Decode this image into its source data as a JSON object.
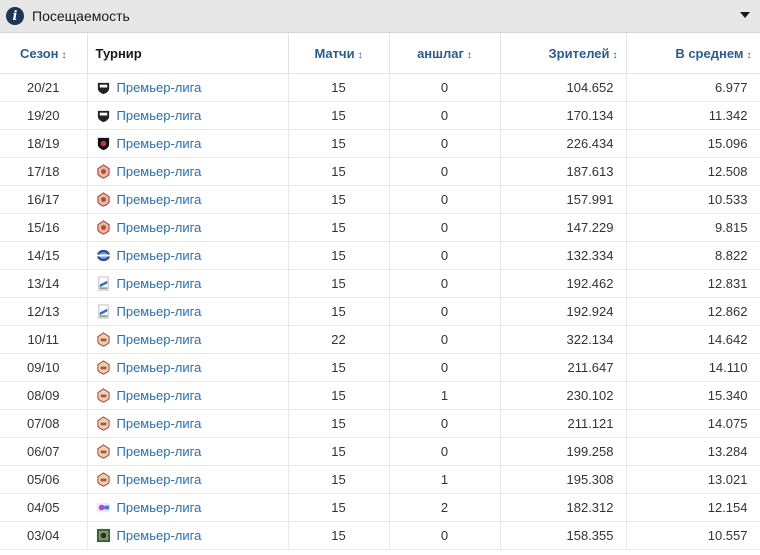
{
  "header": {
    "title": "Посещаемость"
  },
  "columns": [
    "Сезон",
    "Турнир",
    "Матчи",
    "аншлаг",
    "Зрителей",
    "В среднем"
  ],
  "rows": [
    {
      "season": "20/21",
      "league": "Премьер-лига",
      "logo": "black-shield-icon",
      "matches": "15",
      "sellouts": "0",
      "spectators": "104.652",
      "average": "6.977"
    },
    {
      "season": "19/20",
      "league": "Премьер-лига",
      "logo": "black-shield-icon",
      "matches": "15",
      "sellouts": "0",
      "spectators": "170.134",
      "average": "11.342"
    },
    {
      "season": "18/19",
      "league": "Премьер-лига",
      "logo": "black-lion-shield-icon",
      "matches": "15",
      "sellouts": "0",
      "spectators": "226.434",
      "average": "15.096"
    },
    {
      "season": "17/18",
      "league": "Премьер-лига",
      "logo": "red-lion-crest-icon",
      "matches": "15",
      "sellouts": "0",
      "spectators": "187.613",
      "average": "12.508"
    },
    {
      "season": "16/17",
      "league": "Премьер-лига",
      "logo": "red-lion-crest-icon",
      "matches": "15",
      "sellouts": "0",
      "spectators": "157.991",
      "average": "10.533"
    },
    {
      "season": "15/16",
      "league": "Премьер-лига",
      "logo": "red-lion-crest-icon",
      "matches": "15",
      "sellouts": "0",
      "spectators": "147.229",
      "average": "9.815"
    },
    {
      "season": "14/15",
      "league": "Премьер-лига",
      "logo": "blue-oval-badge-icon",
      "matches": "15",
      "sellouts": "0",
      "spectators": "132.334",
      "average": "8.822"
    },
    {
      "season": "13/14",
      "league": "Премьер-лига",
      "logo": "blue-flag-badge-icon",
      "matches": "15",
      "sellouts": "0",
      "spectators": "192.462",
      "average": "12.831"
    },
    {
      "season": "12/13",
      "league": "Премьер-лига",
      "logo": "blue-flag-badge-icon",
      "matches": "15",
      "sellouts": "0",
      "spectators": "192.924",
      "average": "12.862"
    },
    {
      "season": "10/11",
      "league": "Премьер-лига",
      "logo": "brown-crest-icon",
      "matches": "22",
      "sellouts": "0",
      "spectators": "322.134",
      "average": "14.642"
    },
    {
      "season": "09/10",
      "league": "Премьер-лига",
      "logo": "brown-crest-icon",
      "matches": "15",
      "sellouts": "0",
      "spectators": "211.647",
      "average": "14.110"
    },
    {
      "season": "08/09",
      "league": "Премьер-лига",
      "logo": "brown-crest-icon",
      "matches": "15",
      "sellouts": "1",
      "spectators": "230.102",
      "average": "15.340"
    },
    {
      "season": "07/08",
      "league": "Премьер-лига",
      "logo": "brown-crest-icon",
      "matches": "15",
      "sellouts": "0",
      "spectators": "211.121",
      "average": "14.075"
    },
    {
      "season": "06/07",
      "league": "Премьер-лига",
      "logo": "brown-crest-icon",
      "matches": "15",
      "sellouts": "0",
      "spectators": "199.258",
      "average": "13.284"
    },
    {
      "season": "05/06",
      "league": "Премьер-лига",
      "logo": "brown-crest-icon",
      "matches": "15",
      "sellouts": "1",
      "spectators": "195.308",
      "average": "13.021"
    },
    {
      "season": "04/05",
      "league": "Премьер-лига",
      "logo": "colorful-badge-icon",
      "matches": "15",
      "sellouts": "2",
      "spectators": "182.312",
      "average": "12.154"
    },
    {
      "season": "03/04",
      "league": "Премьер-лига",
      "logo": "photo-badge-icon",
      "matches": "15",
      "sellouts": "0",
      "spectators": "158.355",
      "average": "10.557"
    }
  ]
}
